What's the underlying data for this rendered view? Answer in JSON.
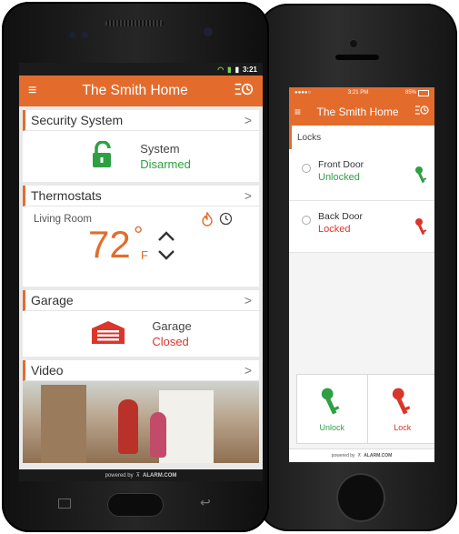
{
  "android": {
    "status_time": "3:21",
    "header_title": "The Smith Home",
    "security": {
      "title": "Security System",
      "status_label": "System",
      "status_value": "Disarmed"
    },
    "thermostat": {
      "title": "Thermostats",
      "room": "Living Room",
      "temperature": "72",
      "degree": "°",
      "unit": "F"
    },
    "garage": {
      "title": "Garage",
      "label": "Garage",
      "status": "Closed"
    },
    "video": {
      "title": "Video"
    },
    "footer": {
      "powered": "powered by",
      "brand": "ALARM.COM"
    }
  },
  "iphone": {
    "status_carrier": "●●●●○",
    "status_time": "3:21 PM",
    "status_battery": "85%",
    "header_title": "The Smith Home",
    "section_title": "Locks",
    "locks": [
      {
        "name": "Front Door",
        "state": "Unlocked"
      },
      {
        "name": "Back Door",
        "state": "Locked"
      }
    ],
    "actions": {
      "unlock": "Unlock",
      "lock": "Lock"
    },
    "footer": {
      "powered": "powered by",
      "brand": "ALARM.COM"
    }
  },
  "colors": {
    "accent": "#e36c2d",
    "green": "#2ea043",
    "red": "#d9362c"
  }
}
